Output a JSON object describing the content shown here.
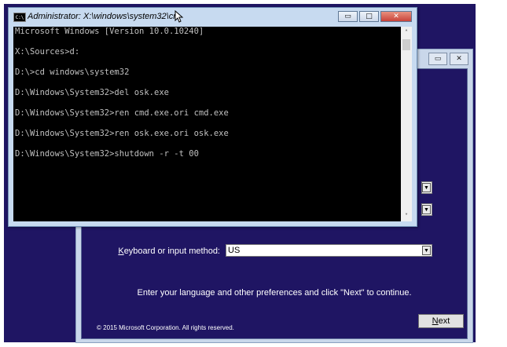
{
  "cmd_window": {
    "title": "Administrator: X:\\windows\\system32\\cmd.exe",
    "icon_label": "C:\\",
    "controls": {
      "minimize": "▭",
      "maximize": "□",
      "close": "✕"
    },
    "lines": [
      "Microsoft Windows [Version 10.0.10240]",
      "",
      "X:\\Sources>d:",
      "",
      "D:\\>cd windows\\system32",
      "",
      "D:\\Windows\\System32>del osk.exe",
      "",
      "D:\\Windows\\System32>ren cmd.exe.ori cmd.exe",
      "",
      "D:\\Windows\\System32>ren osk.exe.ori osk.exe",
      "",
      "D:\\Windows\\System32>shutdown -r -t 00"
    ],
    "scroll_up": "˄",
    "scroll_down": "˅"
  },
  "setup": {
    "controls": {
      "minimize": "▭",
      "close": "✕"
    },
    "keyboard_label_underlined": "K",
    "keyboard_label_rest": "eyboard or input method:",
    "keyboard_value": "US",
    "instruction": "Enter your language and other preferences and click \"Next\" to continue.",
    "copyright": "© 2015 Microsoft Corporation. All rights reserved.",
    "next_underlined": "N",
    "next_rest": "ext",
    "dropdown_arrow": "▼"
  }
}
